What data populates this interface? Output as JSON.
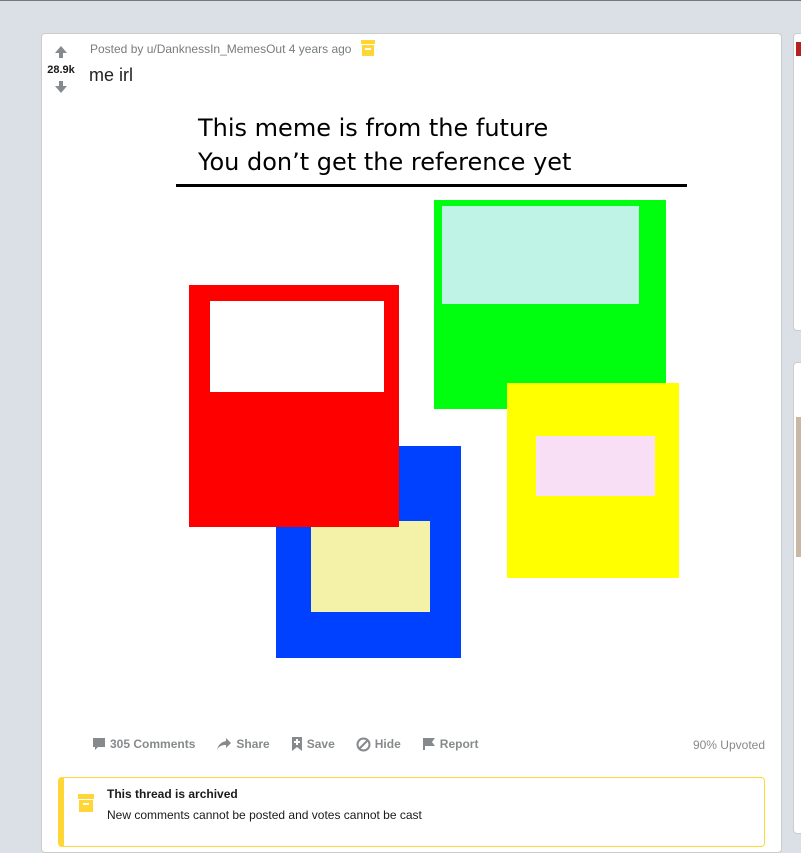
{
  "post": {
    "vote_count": "28.9k",
    "posted_by": "Posted by u/DanknessIn_MemesOut 4 years ago",
    "title": "me irl"
  },
  "meme": {
    "line1": "This meme is from the future",
    "line2": "You don’t get the reference yet",
    "colors": {
      "red": "#ff0000",
      "green": "#00ff0e",
      "blue": "#0041ff",
      "yellow": "#ffff00",
      "mint": "#bff3e5",
      "lavender": "#f8dff6",
      "cream": "#f3f2a8",
      "white": "#ffffff"
    }
  },
  "actions": {
    "comments": "305 Comments",
    "share": "Share",
    "save": "Save",
    "hide": "Hide",
    "report": "Report",
    "upvoted": "90% Upvoted"
  },
  "archived": {
    "title": "This thread is archived",
    "text": "New comments cannot be posted and votes cannot be cast",
    "accent": "#ffd635"
  },
  "icons": [
    "upvote-arrow-icon",
    "downvote-arrow-icon",
    "archive-box-icon",
    "comment-icon",
    "share-icon",
    "save-icon",
    "hide-icon",
    "report-flag-icon"
  ]
}
